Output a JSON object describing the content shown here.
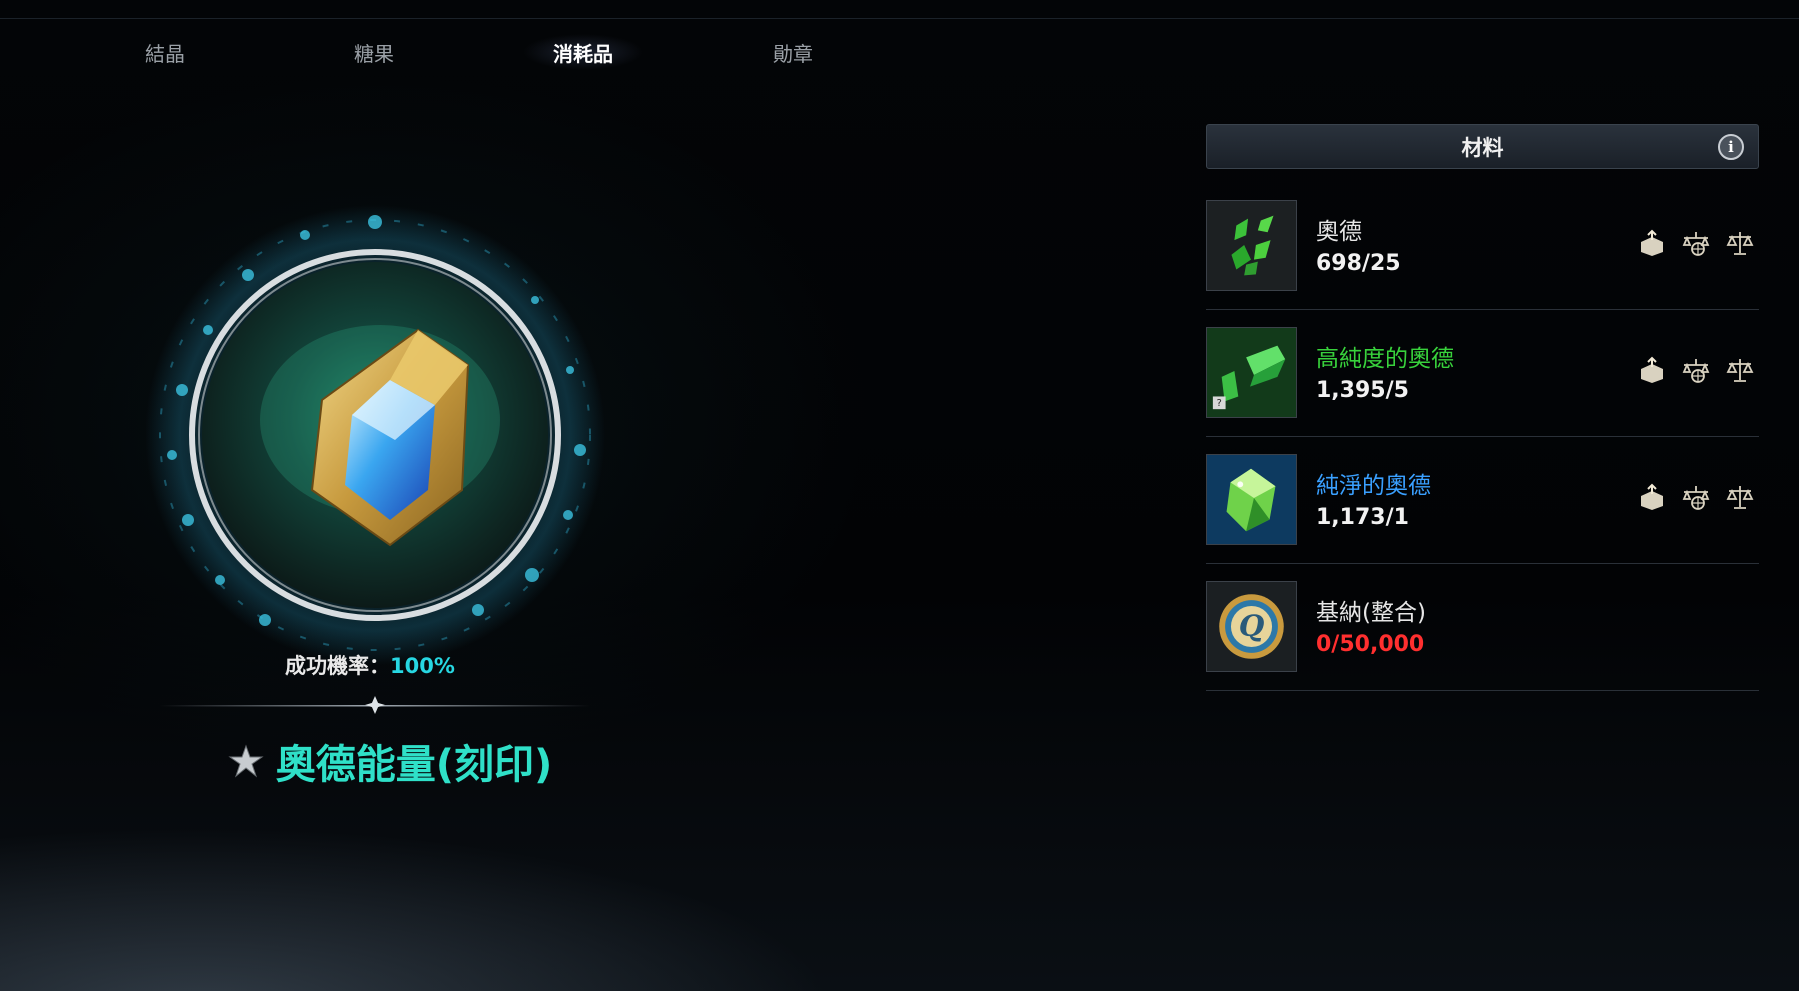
{
  "tabs": [
    {
      "label": "結晶"
    },
    {
      "label": "糖果"
    },
    {
      "label": "消耗品"
    },
    {
      "label": "勛章"
    }
  ],
  "active_tab": "消耗品",
  "result": {
    "rate_label": "成功機率：",
    "rate_value": "100%",
    "name": "奧德能量(刻印)",
    "name_color": "#2fe0c8"
  },
  "materials": {
    "title": "材料",
    "info_icon_glyph": "i",
    "items": [
      {
        "name": "奧德",
        "count": "698/25",
        "name_color": "#e6e6e6",
        "count_color": "#f2f2f2",
        "icon": "green-shards-icon"
      },
      {
        "name": "高純度的奧德",
        "count": "1,395/5",
        "name_color": "#38d23c",
        "count_color": "#f2f2f2",
        "icon": "green-crystal-icon"
      },
      {
        "name": "純淨的奧德",
        "count": "1,173/1",
        "name_color": "#3aa0ff",
        "count_color": "#f2f2f2",
        "icon": "pure-crystal-icon"
      },
      {
        "name": "基納(整合)",
        "count": "0/50,000",
        "name_color": "#e6e6e6",
        "count_color": "#ff2f2f",
        "icon": "kinah-coin-icon"
      }
    ]
  },
  "action_icons": [
    "box-arrow-icon",
    "globe-scale-icon",
    "scale-icon"
  ]
}
